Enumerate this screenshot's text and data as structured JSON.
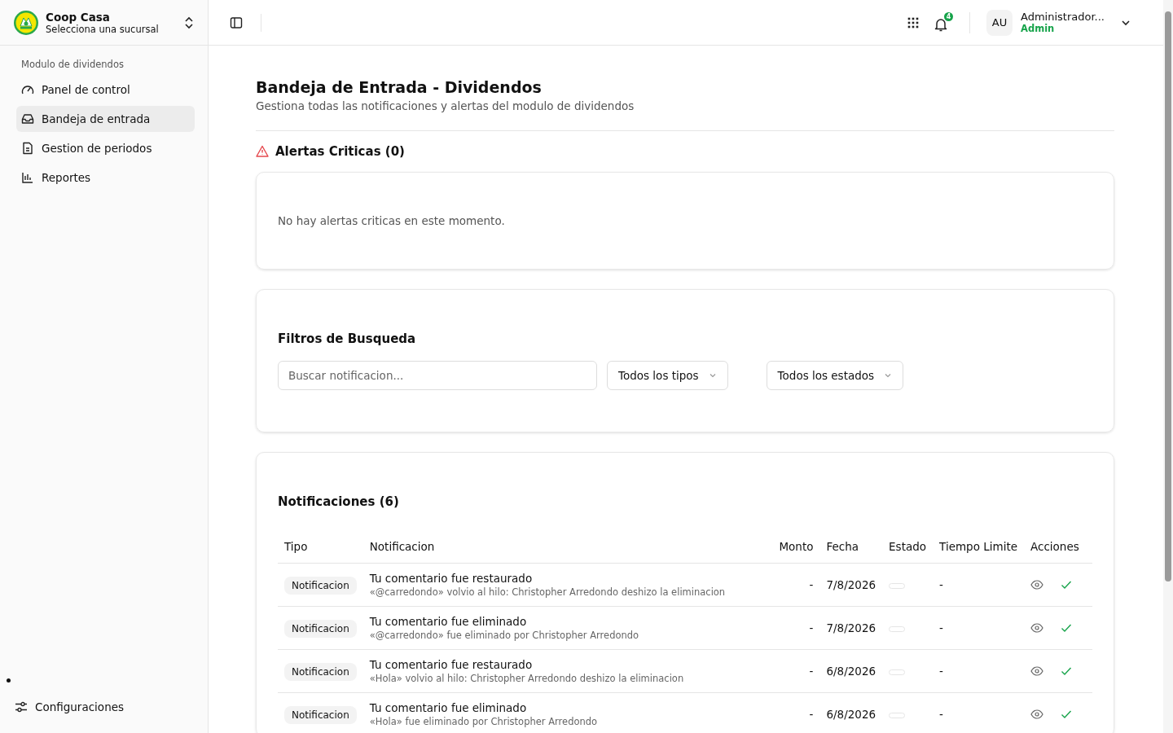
{
  "sidebar": {
    "brand": {
      "name": "Coop Casa",
      "subtitle": "Selecciona una sucursal"
    },
    "section_label": "Modulo de dividendos",
    "items": [
      {
        "label": "Panel de control",
        "selected": false
      },
      {
        "label": "Bandeja de entrada",
        "selected": true
      },
      {
        "label": "Gestion de periodos",
        "selected": false
      },
      {
        "label": "Reportes",
        "selected": false
      }
    ],
    "footer_item": {
      "label": "Configuraciones"
    }
  },
  "header": {
    "notification_count": "4",
    "user": {
      "initials": "AU",
      "name": "Administrador...",
      "role": "Admin"
    }
  },
  "page": {
    "title": "Bandeja de Entrada - Dividendos",
    "subtitle": "Gestiona todas las notificaciones y alertas del modulo de dividendos"
  },
  "alerts": {
    "title": "Alertas Criticas (0)",
    "empty_message": "No hay alertas criticas en este momento."
  },
  "filters": {
    "title": "Filtros de Busqueda",
    "search": {
      "placeholder": "Buscar notificacion..."
    },
    "type_select": "Todos los tipos",
    "status_select": "Todos los estados"
  },
  "notifications": {
    "title": "Notificaciones (6)",
    "columns": [
      "Tipo",
      "Notificacion",
      "Monto",
      "Fecha",
      "Estado",
      "Tiempo Limite",
      "Acciones"
    ],
    "rows": [
      {
        "type": "Notificacion",
        "title": "Tu comentario fue restaurado",
        "detail": "«@carredondo» volvio al hilo: Christopher Arredondo deshizo la eliminacion",
        "amount": "-",
        "date": "7/8/2026",
        "deadline": "-"
      },
      {
        "type": "Notificacion",
        "title": "Tu comentario fue eliminado",
        "detail": "«@carredondo» fue eliminado por Christopher Arredondo",
        "amount": "-",
        "date": "7/8/2026",
        "deadline": "-"
      },
      {
        "type": "Notificacion",
        "title": "Tu comentario fue restaurado",
        "detail": "«Hola» volvio al hilo: Christopher Arredondo deshizo la eliminacion",
        "amount": "-",
        "date": "6/8/2026",
        "deadline": "-"
      },
      {
        "type": "Notificacion",
        "title": "Tu comentario fue eliminado",
        "detail": "«Hola» fue eliminado por Christopher Arredondo",
        "amount": "-",
        "date": "6/8/2026",
        "deadline": "-"
      }
    ]
  }
}
